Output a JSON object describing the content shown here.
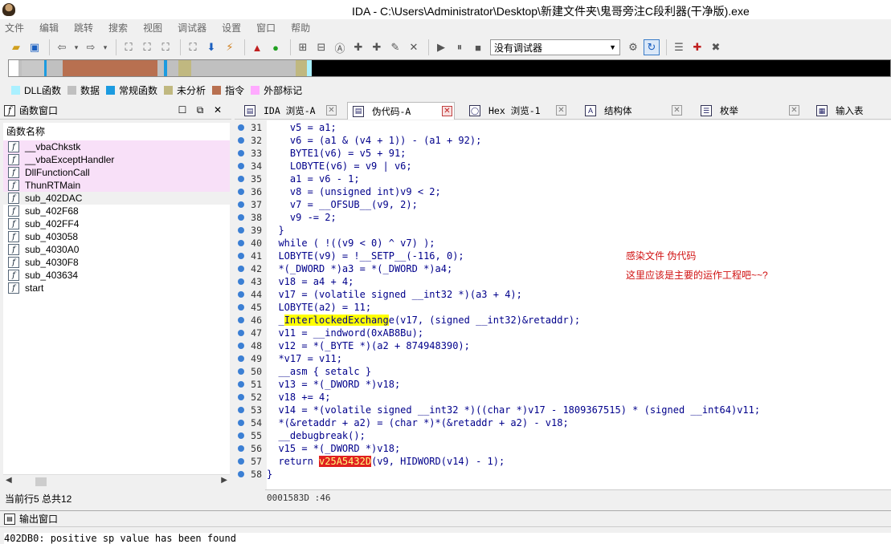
{
  "window": {
    "title": "IDA - C:\\Users\\Administrator\\Desktop\\新建文件夹\\鬼哥旁注C段利器(干净版).exe"
  },
  "menu": [
    "文件",
    "编辑",
    "跳转",
    "搜索",
    "视图",
    "调试器",
    "设置",
    "窗口",
    "帮助"
  ],
  "toolbar": {
    "debugger_select": "没有调试器"
  },
  "legend": [
    {
      "label": "DLL函数",
      "color": "#aaf0ff"
    },
    {
      "label": "数据",
      "color": "#c0c0c0"
    },
    {
      "label": "常规函数",
      "color": "#1b9be0"
    },
    {
      "label": "未分析",
      "color": "#c0b880"
    },
    {
      "label": "指令",
      "color": "#b87050"
    },
    {
      "label": "外部标记",
      "color": "#ffaaff"
    }
  ],
  "func_window": {
    "title": "函数窗口",
    "column": "函数名称",
    "functions": [
      {
        "name": "__vbaChkstk",
        "lib": true
      },
      {
        "name": "__vbaExceptHandler",
        "lib": true
      },
      {
        "name": "DllFunctionCall",
        "lib": true
      },
      {
        "name": "ThunRTMain",
        "lib": true
      },
      {
        "name": "sub_402DAC",
        "lib": false
      },
      {
        "name": "sub_402F68",
        "lib": false
      },
      {
        "name": "sub_402FF4",
        "lib": false
      },
      {
        "name": "sub_403058",
        "lib": false
      },
      {
        "name": "sub_4030A0",
        "lib": false
      },
      {
        "name": "sub_4030F8",
        "lib": false
      },
      {
        "name": "sub_403634",
        "lib": false
      },
      {
        "name": "start",
        "lib": false
      }
    ],
    "status": "当前行5  总共12"
  },
  "tabs": [
    {
      "label": "IDA 浏览-A",
      "active": false
    },
    {
      "label": "伪代码-A",
      "active": true
    },
    {
      "label": "Hex 浏览-1",
      "active": false
    },
    {
      "label": "结构体",
      "active": false
    },
    {
      "label": "枚举",
      "active": false
    },
    {
      "label": "输入表",
      "active": false
    }
  ],
  "code": [
    {
      "n": "31",
      "t": "    v5 = a1;"
    },
    {
      "n": "32",
      "t": "    v6 = (a1 & (v4 + 1)) - (a1 + 92);"
    },
    {
      "n": "33",
      "t": "    BYTE1(v6) = v5 + 91;"
    },
    {
      "n": "34",
      "t": "    LOBYTE(v6) = v9 | v6;"
    },
    {
      "n": "35",
      "t": "    a1 = v6 - 1;"
    },
    {
      "n": "36",
      "t": "    v8 = (unsigned int)v9 < 2;"
    },
    {
      "n": "37",
      "t": "    v7 = __OFSUB__(v9, 2);"
    },
    {
      "n": "38",
      "t": "    v9 -= 2;"
    },
    {
      "n": "39",
      "t": "  }"
    },
    {
      "n": "40",
      "t": "  while ( !((v9 < 0) ^ v7) );"
    },
    {
      "n": "41",
      "t": "  LOBYTE(v9) = !__SETP__(-116, 0);"
    },
    {
      "n": "42",
      "t": "  *(_DWORD *)a3 = *(_DWORD *)a4;"
    },
    {
      "n": "43",
      "t": "  v18 = a4 + 4;"
    },
    {
      "n": "44",
      "t": "  v17 = (volatile signed __int32 *)(a3 + 4);"
    },
    {
      "n": "45",
      "t": "  LOBYTE(a2) = 11;"
    },
    {
      "n": "46",
      "pre": "  _",
      "hy": "InterlockedExchang",
      "post": "e(v17, (signed __int32)&retaddr);"
    },
    {
      "n": "47",
      "t": "  v11 = __indword(0xAB8Bu);"
    },
    {
      "n": "48",
      "t": "  v12 = *(_BYTE *)(a2 + 874948390);"
    },
    {
      "n": "49",
      "t": "  *v17 = v11;"
    },
    {
      "n": "50",
      "t": "  __asm { setalc }"
    },
    {
      "n": "51",
      "t": "  v13 = *(_DWORD *)v18;"
    },
    {
      "n": "52",
      "t": "  v18 += 4;"
    },
    {
      "n": "53",
      "t": "  v14 = *(volatile signed __int32 *)((char *)v17 - 1809367515) * (signed __int64)v11;"
    },
    {
      "n": "54",
      "t": "  *(&retaddr + a2) = (char *)*(&retaddr + a2) - v18;"
    },
    {
      "n": "55",
      "t": "  __debugbreak();"
    },
    {
      "n": "56",
      "t": "  v15 = *(_DWORD *)v18;"
    },
    {
      "n": "57",
      "pre": "  return ",
      "hr": "v25A5432D",
      "post": "(v9, HIDWORD(v14) - 1);"
    },
    {
      "n": "58",
      "t": "}"
    }
  ],
  "annotations": {
    "line1": "感染文件  伪代码",
    "line2": "这里应该是主要的运作工程吧~~?"
  },
  "code_status": "0001583D :46",
  "output_window": {
    "title": "输出窗口",
    "text": "402DB0: positive sp value has been found"
  }
}
